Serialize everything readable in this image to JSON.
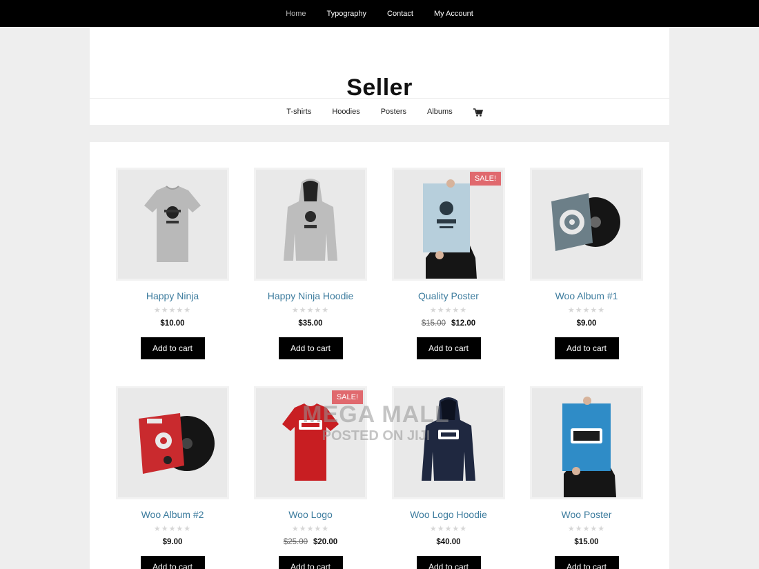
{
  "topnav": {
    "items": [
      {
        "label": "Home",
        "active": true
      },
      {
        "label": "Typography"
      },
      {
        "label": "Contact"
      },
      {
        "label": "My Account"
      }
    ]
  },
  "site": {
    "title": "Seller"
  },
  "subnav": {
    "items": [
      {
        "label": "T-shirts"
      },
      {
        "label": "Hoodies"
      },
      {
        "label": "Posters"
      },
      {
        "label": "Albums"
      }
    ],
    "cart_icon": "cart-icon"
  },
  "products": [
    {
      "name": "Happy Ninja",
      "price": "$10.00",
      "old_price": "",
      "sale": "",
      "button": "Add to cart",
      "stars": "★★★★★",
      "rating": 0,
      "image": "tshirt-gray"
    },
    {
      "name": "Happy Ninja Hoodie",
      "price": "$35.00",
      "old_price": "",
      "sale": "",
      "button": "Add to cart",
      "stars": "★★★★★",
      "rating": 0,
      "image": "hoodie-gray"
    },
    {
      "name": "Quality Poster",
      "price": "$12.00",
      "old_price": "$15.00",
      "sale": "SALE!",
      "button": "Add to cart",
      "stars": "★★★★★",
      "rating": 0,
      "image": "poster-light"
    },
    {
      "name": "Woo Album #1",
      "price": "$9.00",
      "old_price": "",
      "sale": "",
      "button": "Add to cart",
      "stars": "★★★★★",
      "rating": 0,
      "image": "album-gray"
    },
    {
      "name": "Woo Album #2",
      "price": "$9.00",
      "old_price": "",
      "sale": "",
      "button": "Add to cart",
      "stars": "★★★★★",
      "rating": 0,
      "image": "album-red"
    },
    {
      "name": "Woo Logo",
      "price": "$20.00",
      "old_price": "$25.00",
      "sale": "SALE!",
      "button": "Add to cart",
      "stars": "★★★★★",
      "rating": 0,
      "image": "tshirt-red"
    },
    {
      "name": "Woo Logo Hoodie",
      "price": "$40.00",
      "old_price": "",
      "sale": "",
      "button": "Add to cart",
      "stars": "★★★★★",
      "rating": 0,
      "image": "hoodie-navy"
    },
    {
      "name": "Woo Poster",
      "price": "$15.00",
      "old_price": "",
      "sale": "",
      "button": "Add to cart",
      "stars": "★★★★★",
      "rating": 0,
      "image": "poster-blue"
    }
  ],
  "watermark": {
    "line1": "MEGA MALL",
    "line2": "POSTED ON JIJI"
  },
  "colors": {
    "accent_link": "#3d7c9e",
    "sale_badge": "#e0696e",
    "topbar": "#000000",
    "page_bg": "#eeeeee"
  }
}
